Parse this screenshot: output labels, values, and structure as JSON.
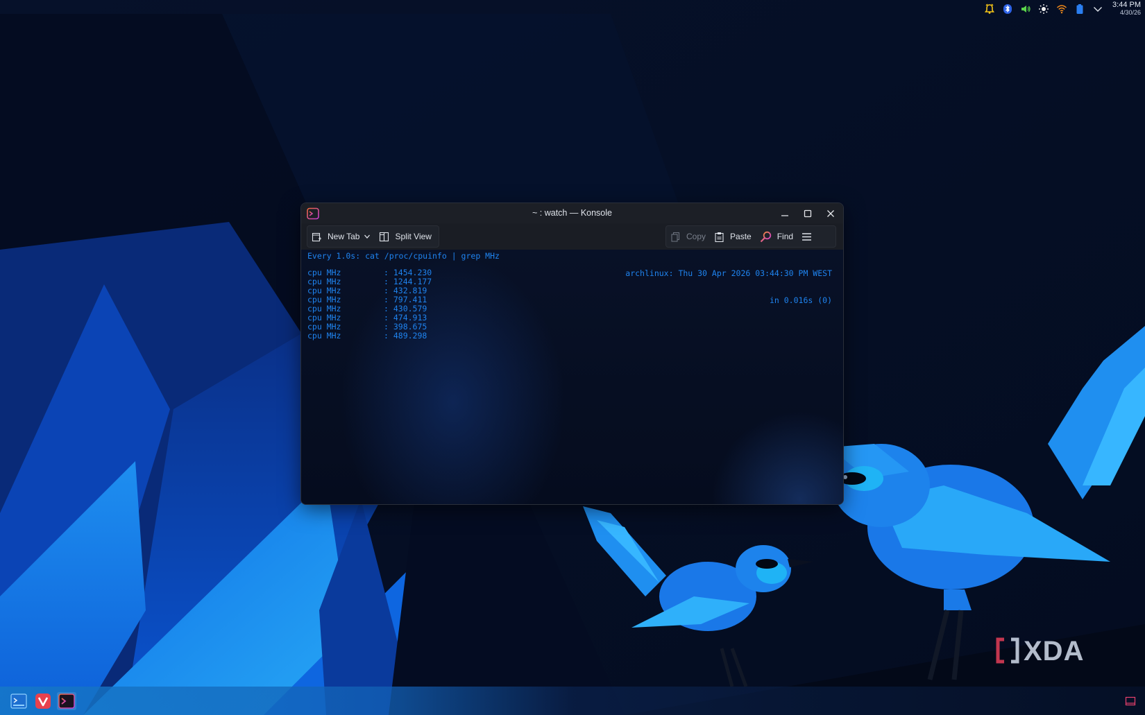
{
  "tray": {
    "icons": [
      "notification-bell-icon",
      "bluetooth-icon",
      "volume-icon",
      "brightness-icon",
      "wifi-icon",
      "battery-icon",
      "expand-tray-icon"
    ],
    "time": "3:44 PM",
    "date": "4/30/26"
  },
  "window": {
    "title": "~ : watch — Konsole",
    "app_icon": "konsole-icon"
  },
  "toolbar": {
    "new_tab_label": "New Tab",
    "split_view_label": "Split View",
    "copy_label": "Copy",
    "paste_label": "Paste",
    "find_label": "Find"
  },
  "terminal": {
    "header_left": "Every 1.0s: cat /proc/cpuinfo | grep MHz",
    "header_right": "archlinux: Thu 30 Apr 2026 03:44:30 PM WEST",
    "header_right_sub": "in 0.016s (0)",
    "lines": [
      {
        "label": "cpu MHz",
        "value": ": 1454.230"
      },
      {
        "label": "cpu MHz",
        "value": ": 1244.177"
      },
      {
        "label": "cpu MHz",
        "value": ": 432.819"
      },
      {
        "label": "cpu MHz",
        "value": ": 797.411"
      },
      {
        "label": "cpu MHz",
        "value": ": 430.579"
      },
      {
        "label": "cpu MHz",
        "value": ": 474.913"
      },
      {
        "label": "cpu MHz",
        "value": ": 398.675"
      },
      {
        "label": "cpu MHz",
        "value": ": 489.298"
      }
    ]
  },
  "taskbar": {
    "apps": [
      "dolphin-file-manager-icon",
      "vivaldi-browser-icon",
      "konsole-icon"
    ],
    "show_desktop_icon": "show-desktop-icon"
  },
  "watermark": {
    "text": "XDA"
  },
  "colors": {
    "terminal_text": "#1f84f0",
    "titlebar": "#1c1f26",
    "accent_pink": "#e8416d"
  }
}
